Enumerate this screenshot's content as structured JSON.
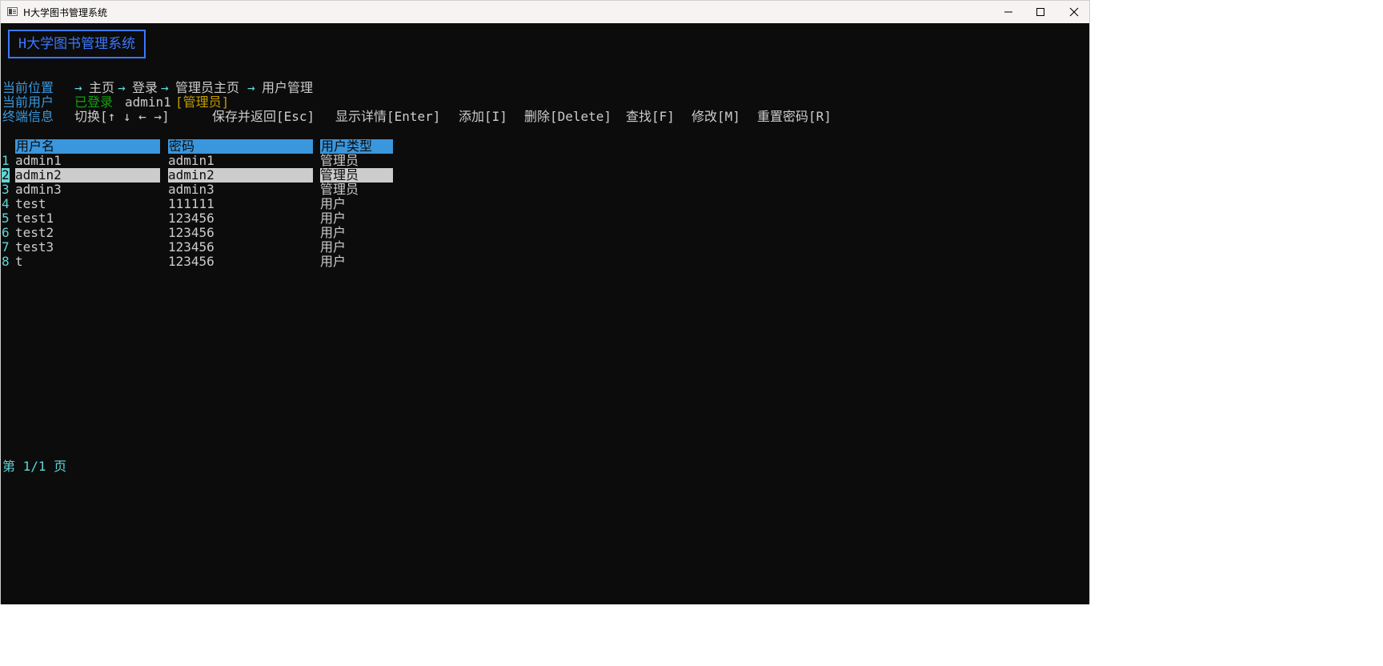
{
  "window": {
    "title": "H大学图书管理系统",
    "controls": {
      "minimize": "minimize-icon",
      "maximize": "maximize-icon",
      "close": "close-icon"
    }
  },
  "app": {
    "logo": "H大学图书管理系统"
  },
  "status": {
    "location_label": "当前位置",
    "breadcrumb": [
      "主页",
      "登录",
      "管理员主页",
      "用户管理"
    ],
    "breadcrumb_arrow": "→",
    "user_label": "当前用户",
    "login_state": "已登录",
    "username": "admin1",
    "role": "[管理员]",
    "terminal_label": "终端信息",
    "shortcuts": {
      "switch": "切换[↑ ↓ ← →]",
      "save_return": "保存并返回[Esc]",
      "details": "显示详情[Enter]",
      "add": "添加[I]",
      "delete": "删除[Delete]",
      "find": "查找[F]",
      "modify": "修改[M]",
      "reset_password": "重置密码[R]"
    }
  },
  "table": {
    "headers": [
      "用户名",
      "密码",
      "用户类型"
    ],
    "selected_row": 1,
    "rows": [
      {
        "index": "1",
        "username": "admin1",
        "password": "admin1",
        "type": "管理员"
      },
      {
        "index": "2",
        "username": "admin2",
        "password": "admin2",
        "type": "管理员"
      },
      {
        "index": "3",
        "username": "admin3",
        "password": "admin3",
        "type": "管理员"
      },
      {
        "index": "4",
        "username": "test",
        "password": "111111",
        "type": "用户"
      },
      {
        "index": "5",
        "username": "test1",
        "password": "123456",
        "type": "用户"
      },
      {
        "index": "6",
        "username": "test2",
        "password": "123456",
        "type": "用户"
      },
      {
        "index": "7",
        "username": "test3",
        "password": "123456",
        "type": "用户"
      },
      {
        "index": "8",
        "username": "t",
        "password": "123456",
        "type": "用户"
      }
    ]
  },
  "pager": {
    "text": "第 1/1 页"
  },
  "colors": {
    "console_bg": "#0c0c0c",
    "text": "#cccccc",
    "label_blue": "#3a96dd",
    "cyan": "#61d6d6",
    "green": "#13a10e",
    "yellow": "#c19c00",
    "logo_blue": "#3b78ff",
    "selection": "#cccccc"
  }
}
